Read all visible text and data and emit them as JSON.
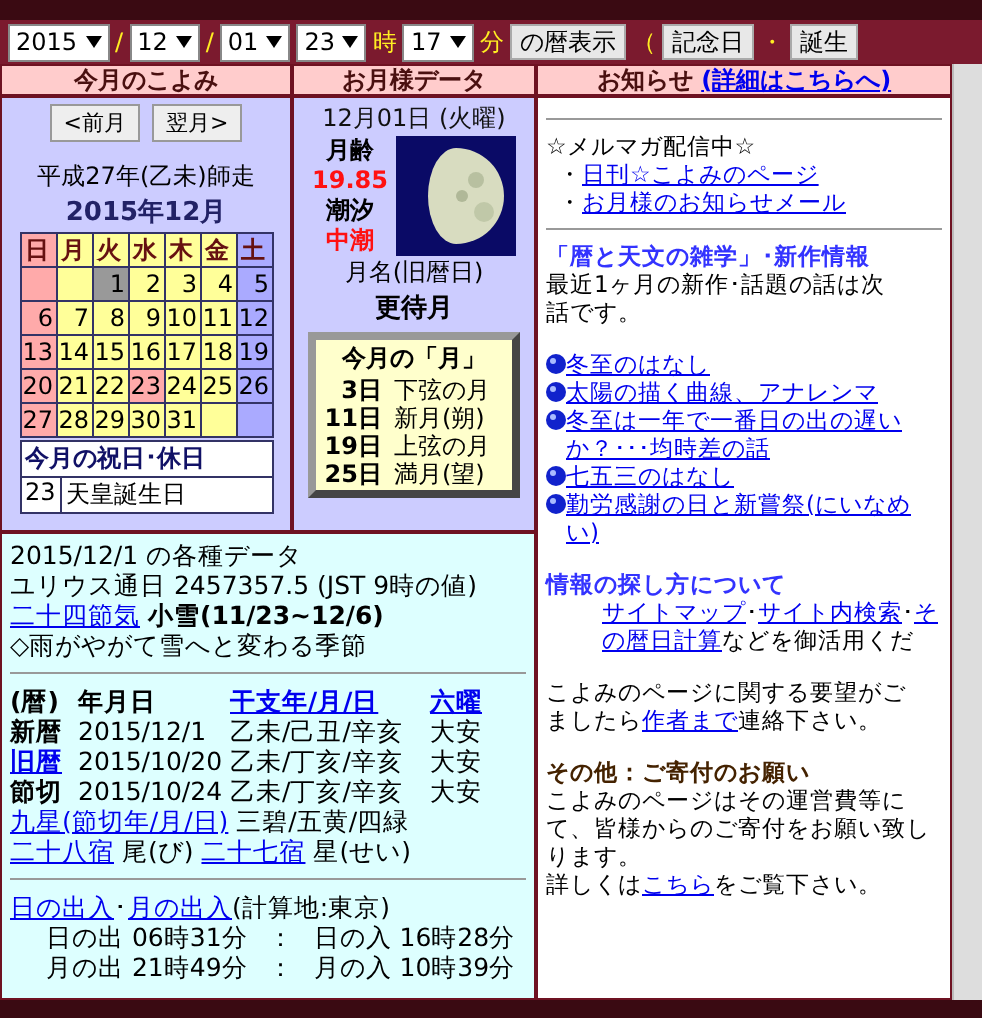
{
  "toolbar": [
    {
      "kind": "select",
      "value": "2015"
    },
    {
      "kind": "label",
      "text": "/"
    },
    {
      "kind": "select",
      "value": "12"
    },
    {
      "kind": "label",
      "text": "/"
    },
    {
      "kind": "select",
      "value": "01"
    },
    {
      "kind": "select",
      "value": "23"
    },
    {
      "kind": "label",
      "text": "時"
    },
    {
      "kind": "select",
      "value": "17"
    },
    {
      "kind": "label",
      "text": "分"
    },
    {
      "kind": "button",
      "text": "の暦表示"
    },
    {
      "kind": "label",
      "text": "（"
    },
    {
      "kind": "button",
      "text": "記念日"
    },
    {
      "kind": "label",
      "text": "・"
    },
    {
      "kind": "button",
      "text": "誕生"
    }
  ],
  "headers": [
    {
      "text": "今月のこよみ"
    },
    {
      "text": "お月様データ"
    },
    {
      "text": "お知らせ",
      "link": "(詳細はこちらへ)"
    }
  ],
  "calendar": {
    "nav": [
      "<前月",
      "翌月>"
    ],
    "era": "平成27年(乙未)師走",
    "month": "2015年12月",
    "weekdays": [
      {
        "label": "日",
        "kind": "sunday"
      },
      {
        "label": "月",
        "kind": "weekday"
      },
      {
        "label": "火",
        "kind": "weekday"
      },
      {
        "label": "水",
        "kind": "weekday"
      },
      {
        "label": "木",
        "kind": "weekday"
      },
      {
        "label": "金",
        "kind": "weekday"
      },
      {
        "label": "土",
        "kind": "saturday"
      }
    ],
    "weeks": [
      [
        {
          "kind": "sunday",
          "selected": false
        },
        {
          "kind": "weekday",
          "selected": false
        },
        {
          "day": "1",
          "kind": "weekday",
          "selected": true
        },
        {
          "day": "2",
          "kind": "weekday",
          "selected": false
        },
        {
          "day": "3",
          "kind": "weekday",
          "selected": false
        },
        {
          "day": "4",
          "kind": "weekday",
          "selected": false
        },
        {
          "day": "5",
          "kind": "saturday",
          "selected": false
        }
      ],
      [
        {
          "day": "6",
          "kind": "sunday",
          "selected": false
        },
        {
          "day": "7",
          "kind": "weekday",
          "selected": false
        },
        {
          "day": "8",
          "kind": "weekday",
          "selected": false
        },
        {
          "day": "9",
          "kind": "weekday",
          "selected": false
        },
        {
          "day": "10",
          "kind": "weekday",
          "selected": false
        },
        {
          "day": "11",
          "kind": "weekday",
          "selected": false
        },
        {
          "day": "12",
          "kind": "saturday",
          "selected": false
        }
      ],
      [
        {
          "day": "13",
          "kind": "sunday",
          "selected": false
        },
        {
          "day": "14",
          "kind": "weekday",
          "selected": false
        },
        {
          "day": "15",
          "kind": "weekday",
          "selected": false
        },
        {
          "day": "16",
          "kind": "weekday",
          "selected": false
        },
        {
          "day": "17",
          "kind": "weekday",
          "selected": false
        },
        {
          "day": "18",
          "kind": "weekday",
          "selected": false
        },
        {
          "day": "19",
          "kind": "saturday",
          "selected": false
        }
      ],
      [
        {
          "day": "20",
          "kind": "sunday",
          "selected": false
        },
        {
          "day": "21",
          "kind": "weekday",
          "selected": false
        },
        {
          "day": "22",
          "kind": "weekday",
          "selected": false
        },
        {
          "day": "23",
          "kind": "holiday",
          "selected": false
        },
        {
          "day": "24",
          "kind": "weekday",
          "selected": false
        },
        {
          "day": "25",
          "kind": "weekday",
          "selected": false
        },
        {
          "day": "26",
          "kind": "saturday",
          "selected": false
        }
      ],
      [
        {
          "day": "27",
          "kind": "sunday",
          "selected": false
        },
        {
          "day": "28",
          "kind": "weekday",
          "selected": false
        },
        {
          "day": "29",
          "kind": "weekday",
          "selected": false
        },
        {
          "day": "30",
          "kind": "weekday",
          "selected": false
        },
        {
          "day": "31",
          "kind": "weekday",
          "selected": false
        },
        {
          "kind": "weekday",
          "selected": false
        },
        {
          "kind": "saturday",
          "selected": false
        }
      ]
    ],
    "holidays_title": "今月の祝日･休日",
    "holidays": [
      {
        "day": "23",
        "name": "天皇誕生日"
      }
    ]
  },
  "moon": {
    "date": "12月01日 (火曜)",
    "age_label": "月齢",
    "age": "19.85",
    "tide_label": "潮汐",
    "tide": "中潮",
    "name_label": "月名(旧暦日)",
    "name": "更待月",
    "phases_title": "今月の「月」",
    "phases": [
      {
        "day": "3日",
        "name": "下弦の月"
      },
      {
        "day": "11日",
        "name": "新月(朔)"
      },
      {
        "day": "19日",
        "name": "上弦の月"
      },
      {
        "day": "25日",
        "name": "満月(望)"
      }
    ]
  },
  "data": {
    "title": "2015/12/1 の各種データ",
    "julian": "ユリウス通日 2457357.5 (JST 9時の値)",
    "sekki_link": "二十四節気",
    "sekki": "小雪(11/23~12/6)",
    "season": "◇雨がやがて雪へと変わる季節",
    "columns": [
      {
        "text": "(暦)",
        "kind": "text"
      },
      {
        "text": "年月日",
        "kind": "text"
      },
      {
        "text": "干支年/月/日",
        "kind": "link"
      },
      {
        "text": "六曜",
        "kind": "link"
      }
    ],
    "rows": [
      {
        "label": "新暦",
        "kind": "text",
        "date": "2015/12/1",
        "eto": "乙未/己丑/辛亥",
        "rokuyo": "大安"
      },
      {
        "label": "旧暦",
        "kind": "link",
        "date": "2015/10/20",
        "eto": "乙未/丁亥/辛亥",
        "rokuyo": "大安"
      },
      {
        "label": "節切",
        "kind": "text",
        "date": "2015/10/24",
        "eto": "乙未/丁亥/辛亥",
        "rokuyo": "大安"
      }
    ],
    "kyusei_link": "九星(節切年/月/日)",
    "kyusei": "三碧/五黄/四緑",
    "shuku28_link": "二十八宿",
    "shuku28": "尾(び)",
    "shuku27_link": "二十七宿",
    "shuku27": "星(せい)",
    "sun_link": "日の出入",
    "sep": "･",
    "moon_link": "月の出入",
    "place": "(計算地:東京)",
    "rise_set": [
      {
        "rise": "日の出 06時31分",
        "sep": "：",
        "set": "日の入 16時28分"
      },
      {
        "rise": "月の出 21時49分",
        "sep": "：",
        "set": "月の入 10時39分"
      }
    ]
  },
  "news": {
    "mail_title": "☆メルマガ配信中☆",
    "mail_links": [
      {
        "bullet": "・",
        "text": "日刊☆こよみのページ"
      },
      {
        "bullet": "・",
        "text": "お月様のお知らせメール"
      }
    ],
    "articles_title": "「暦と天文の雑学」･新作情報",
    "articles_intro": [
      "最近1ヶ月の新作･話題の話は次",
      "話です。"
    ],
    "articles": [
      {
        "lines": [
          "冬至のはなし"
        ]
      },
      {
        "lines": [
          "太陽の描く曲線、アナレンマ"
        ]
      },
      {
        "lines": [
          "冬至は一年で一番日の出の遅い",
          "か？･･･均時差の話"
        ]
      },
      {
        "lines": [
          "七五三のはなし"
        ]
      },
      {
        "lines": [
          "勤労感謝の日と新嘗祭(にいなめ",
          "い)"
        ]
      }
    ],
    "search_title": "情報の探し方について",
    "search_lines": [
      [
        {
          "text": "サイトマップ",
          "kind": "link"
        },
        {
          "text": "･",
          "kind": "text"
        },
        {
          "text": "サイト内検索",
          "kind": "link"
        },
        {
          "text": "･",
          "kind": "text"
        },
        {
          "text": "そ",
          "kind": "link"
        }
      ],
      [
        {
          "text": "の暦日計算",
          "kind": "link"
        },
        {
          "text": "などを御活用くだ",
          "kind": "text"
        }
      ]
    ],
    "request_lines": [
      [
        {
          "text": "こよみのページに関する要望がご",
          "kind": "text"
        }
      ],
      [
        {
          "text": "ましたら",
          "kind": "text"
        },
        {
          "text": "作者まで",
          "kind": "link"
        },
        {
          "text": "連絡下さい。",
          "kind": "text"
        }
      ]
    ],
    "donation_title": "その他：ご寄付のお願い",
    "donation_lines": [
      [
        {
          "text": "こよみのページはその運営費等に",
          "kind": "text"
        }
      ],
      [
        {
          "text": "て、皆様からのご寄付をお願い致し",
          "kind": "text"
        }
      ],
      [
        {
          "text": "ります。",
          "kind": "text"
        }
      ],
      [
        {
          "text": "詳しくは",
          "kind": "text"
        },
        {
          "text": "こちら",
          "kind": "link"
        },
        {
          "text": "をご覧下さい。",
          "kind": "text"
        }
      ]
    ]
  }
}
